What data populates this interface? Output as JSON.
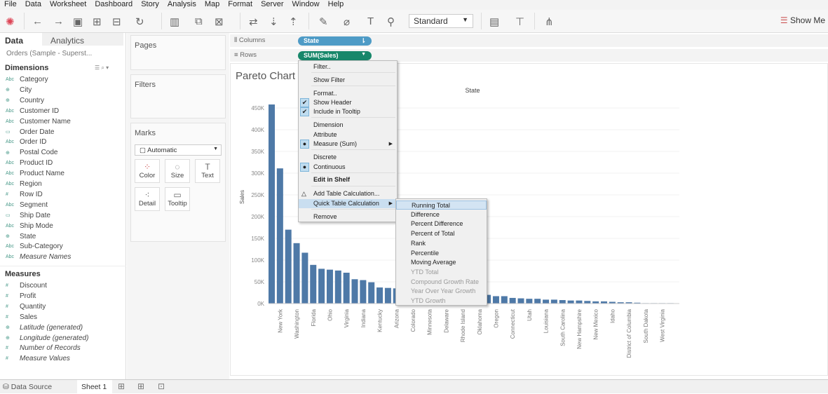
{
  "menubar": [
    "File",
    "Data",
    "Worksheet",
    "Dashboard",
    "Story",
    "Analysis",
    "Map",
    "Format",
    "Server",
    "Window",
    "Help"
  ],
  "toolbar": {
    "fit_select": "Standard",
    "show_me": "Show Me"
  },
  "left": {
    "tab_data": "Data",
    "tab_analytics": "Analytics",
    "datasource": "Orders (Sample - Superst...",
    "dimensions_header": "Dimensions",
    "measures_header": "Measures",
    "dimensions": [
      {
        "label": "Category",
        "icon": "Abc"
      },
      {
        "label": "City",
        "icon": "⊕"
      },
      {
        "label": "Country",
        "icon": "⊕"
      },
      {
        "label": "Customer ID",
        "icon": "Abc"
      },
      {
        "label": "Customer Name",
        "icon": "Abc"
      },
      {
        "label": "Order Date",
        "icon": "▭"
      },
      {
        "label": "Order ID",
        "icon": "Abc"
      },
      {
        "label": "Postal Code",
        "icon": "⊕"
      },
      {
        "label": "Product ID",
        "icon": "Abc"
      },
      {
        "label": "Product Name",
        "icon": "Abc"
      },
      {
        "label": "Region",
        "icon": "Abc"
      },
      {
        "label": "Row ID",
        "icon": "#"
      },
      {
        "label": "Segment",
        "icon": "Abc"
      },
      {
        "label": "Ship Date",
        "icon": "▭"
      },
      {
        "label": "Ship Mode",
        "icon": "Abc"
      },
      {
        "label": "State",
        "icon": "⊕"
      },
      {
        "label": "Sub-Category",
        "icon": "Abc"
      },
      {
        "label": "Measure Names",
        "icon": "Abc",
        "italic": true
      }
    ],
    "measures": [
      {
        "label": "Discount",
        "icon": "#"
      },
      {
        "label": "Profit",
        "icon": "#"
      },
      {
        "label": "Quantity",
        "icon": "#"
      },
      {
        "label": "Sales",
        "icon": "#"
      },
      {
        "label": "Latitude (generated)",
        "icon": "⊕",
        "italic": true
      },
      {
        "label": "Longitude (generated)",
        "icon": "⊕",
        "italic": true
      },
      {
        "label": "Number of Records",
        "icon": "#",
        "italic": true
      },
      {
        "label": "Measure Values",
        "icon": "#",
        "italic": true
      }
    ]
  },
  "cards": {
    "pages": "Pages",
    "filters": "Filters",
    "marks": "Marks",
    "mark_type": "Automatic",
    "buttons": [
      "Color",
      "Size",
      "Text",
      "Detail",
      "Tooltip"
    ]
  },
  "shelves": {
    "columns_label": "Columns",
    "rows_label": "Rows",
    "columns_pill": "State",
    "rows_pill": "SUM(Sales)",
    "columns_color": "#4e9bc6",
    "rows_color": "#17876a"
  },
  "context_menu": {
    "items": [
      "Filter..",
      "Show Filter",
      "Format..",
      "Show Header",
      "Include in Tooltip",
      "Dimension",
      "Attribute",
      "Measure (Sum)",
      "Discrete",
      "Continuous",
      "Edit in Shelf",
      "Add Table Calculation...",
      "Quick Table Calculation",
      "Remove"
    ]
  },
  "submenu": {
    "items": [
      "Running Total",
      "Difference",
      "Percent Difference",
      "Percent of Total",
      "Rank",
      "Percentile",
      "Moving Average"
    ],
    "disabled_items": [
      "YTD Total",
      "Compound Growth Rate",
      "Year Over Year Growth",
      "YTD Growth"
    ]
  },
  "bottom": {
    "data_source": "Data Source",
    "sheet": "Sheet 1"
  },
  "chart_data": {
    "type": "bar",
    "title": "Pareto Chart",
    "xlabel": "State",
    "ylabel": "Sales",
    "ylim": [
      0,
      460000
    ],
    "bar_color": "#4e79a7",
    "yticks": [
      "0K",
      "50K",
      "100K",
      "150K",
      "200K",
      "250K",
      "300K",
      "350K",
      "400K",
      "450K"
    ],
    "categories": [
      "",
      "New York",
      "",
      "Washington",
      "",
      "Florida",
      "",
      "Ohio",
      "",
      "Virginia",
      "",
      "Indiana",
      "",
      "Kentucky",
      "",
      "Arizona",
      "",
      "Colorado",
      "",
      "Minnesota",
      "",
      "Delaware",
      "",
      "Rhode Island",
      "",
      "Oklahoma",
      "",
      "Oregon",
      "",
      "Connecticut",
      "",
      "Utah",
      "",
      "Louisiana",
      "",
      "South Carolina",
      "",
      "New Hampshire",
      "",
      "New Mexico",
      "",
      "Idaho",
      "",
      "District of Columbia",
      "",
      "South Dakota",
      "",
      "West Virginia",
      ""
    ],
    "values": [
      458000,
      311000,
      170000,
      139000,
      117000,
      89000,
      80000,
      78000,
      76000,
      71000,
      56000,
      54000,
      49000,
      37000,
      36000,
      35000,
      32000,
      32000,
      31000,
      30000,
      29000,
      27000,
      24000,
      23000,
      22000,
      20000,
      20000,
      17000,
      17000,
      13000,
      12000,
      11000,
      11000,
      9000,
      9000,
      8000,
      7000,
      7000,
      6000,
      5000,
      5000,
      4000,
      3000,
      3000,
      2000,
      1000,
      1000,
      1000,
      1000
    ]
  }
}
